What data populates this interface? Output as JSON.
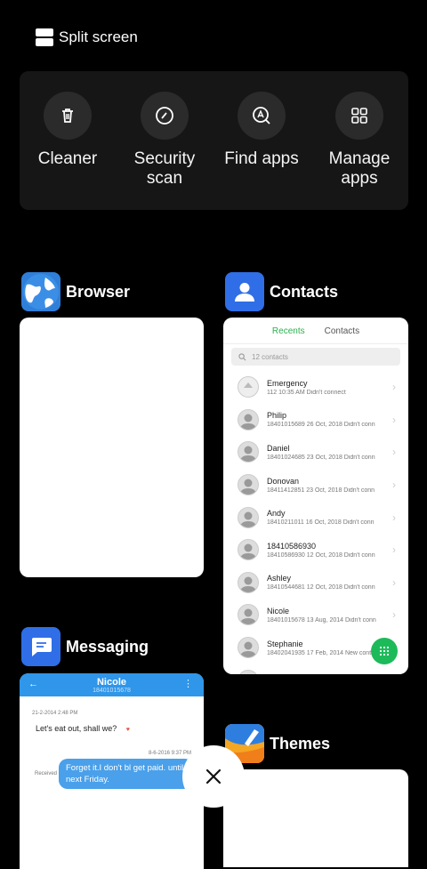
{
  "header": {
    "split_label": "Split screen",
    "icon": "split-screen-icon"
  },
  "quick_actions": [
    {
      "label": "Cleaner",
      "icon": "trash-icon"
    },
    {
      "label": "Security\nscan",
      "icon": "security-icon"
    },
    {
      "label": "Find apps",
      "icon": "find-apps-icon"
    },
    {
      "label": "Manage\napps",
      "icon": "manage-apps-icon"
    }
  ],
  "apps": {
    "browser": {
      "name": "Browser",
      "icon": "browser-globe-icon"
    },
    "contacts": {
      "name": "Contacts",
      "icon": "contacts-person-icon",
      "tab_recents": "Recents",
      "tab_contacts": "Contacts",
      "search_placeholder": "12 contacts",
      "rows": [
        {
          "name": "Emergency",
          "detail": "112 10:35 AM Didn't connect"
        },
        {
          "name": "Philip",
          "detail": "18401015689 26 Oct, 2018 Didn't conn"
        },
        {
          "name": "Daniel",
          "detail": "18401024685 23 Oct, 2018 Didn't conn"
        },
        {
          "name": "Donovan",
          "detail": "18411412851 23 Oct, 2018 Didn't conn"
        },
        {
          "name": "Andy",
          "detail": "18410211011 16 Oct, 2018 Didn't conn"
        },
        {
          "name": "18410586930",
          "detail": "18410586930 12 Oct, 2018 Didn't conn"
        },
        {
          "name": "Ashley",
          "detail": "18410544681 12 Oct, 2018 Didn't conn"
        },
        {
          "name": "Nicole",
          "detail": "18401015678 13 Aug, 2014 Didn't conn"
        },
        {
          "name": "Stephanie",
          "detail": "18402041935 17 Feb, 2014 New contac"
        },
        {
          "name": "Jeanine",
          "detail": ""
        }
      ]
    },
    "messaging": {
      "name": "Messaging",
      "icon": "messaging-bubble-icon",
      "contact_name": "Nicole",
      "contact_number": "18401015678",
      "date1": "21-2-2014 2:48 PM",
      "msg1": "Let's eat out, shall we?",
      "date2": "8-6-2016 9:37 PM",
      "received_label": "Received",
      "msg2": "Forget it.I don't bl get paid. until next Friday."
    },
    "themes": {
      "name": "Themes",
      "icon": "themes-brush-icon"
    }
  },
  "close_icon": "close-x-icon"
}
